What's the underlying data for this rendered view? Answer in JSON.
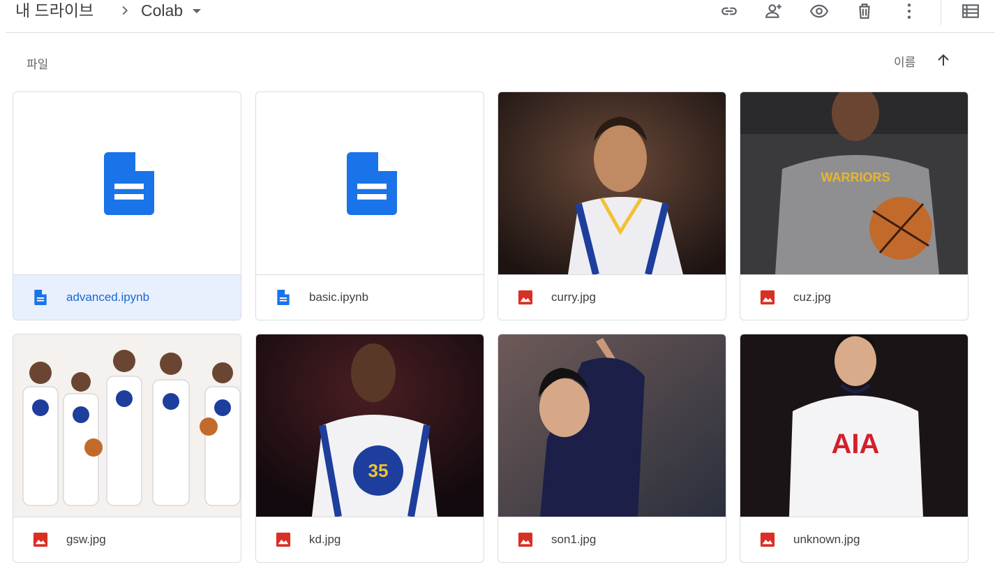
{
  "breadcrumb": {
    "root": "내 드라이브",
    "current": "Colab"
  },
  "toolbar": {
    "icons": [
      "link-icon",
      "add-person-icon",
      "eye-icon",
      "trash-icon",
      "more-vert-icon",
      "list-view-icon"
    ]
  },
  "section": {
    "label": "파일"
  },
  "sort": {
    "label": "이름",
    "direction": "ascending"
  },
  "colors": {
    "doc_blue": "#1a73e8",
    "image_red": "#d93025",
    "selected_bg": "#e8f0fe",
    "selected_text": "#1967d2"
  },
  "files": [
    {
      "name": "advanced.ipynb",
      "type": "document",
      "selected": true
    },
    {
      "name": "basic.ipynb",
      "type": "document",
      "selected": false
    },
    {
      "name": "curry.jpg",
      "type": "image",
      "selected": false
    },
    {
      "name": "cuz.jpg",
      "type": "image",
      "selected": false
    },
    {
      "name": "gsw.jpg",
      "type": "image",
      "selected": false
    },
    {
      "name": "kd.jpg",
      "type": "image",
      "selected": false
    },
    {
      "name": "son1.jpg",
      "type": "image",
      "selected": false
    },
    {
      "name": "unknown.jpg",
      "type": "image",
      "selected": false
    }
  ]
}
